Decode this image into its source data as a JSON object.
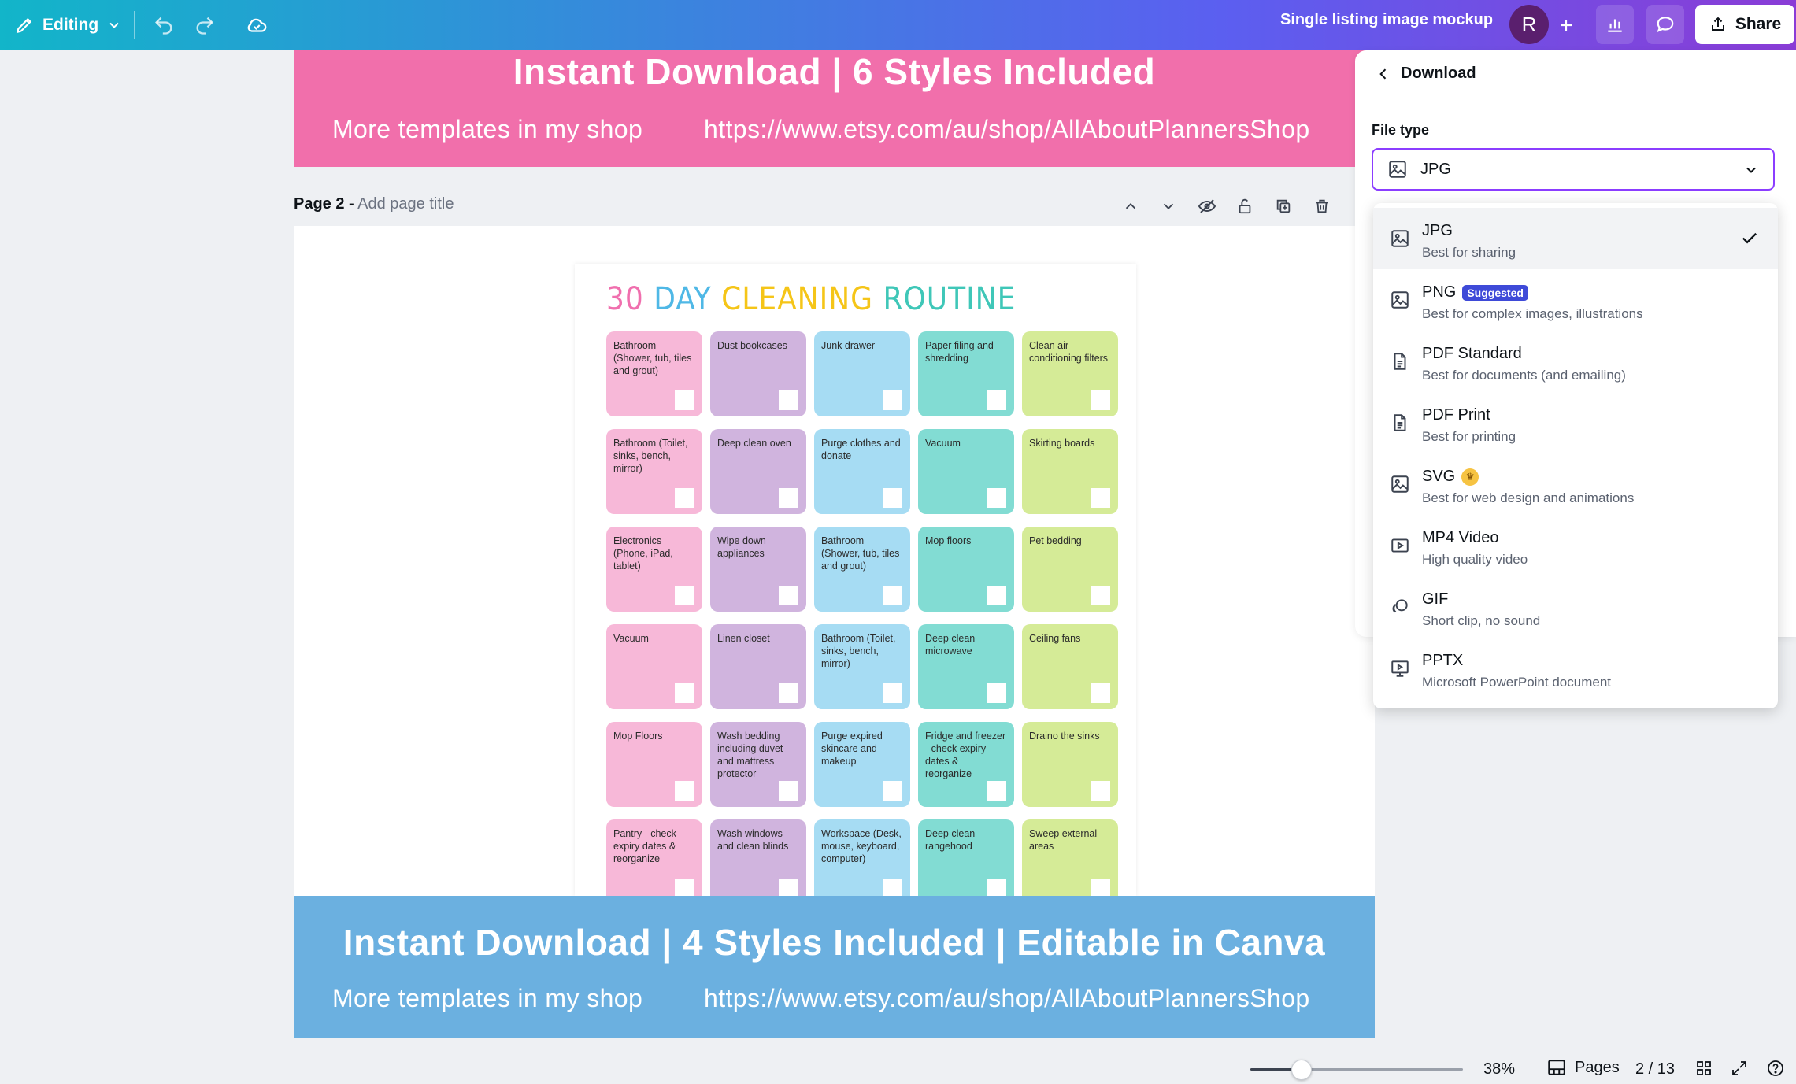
{
  "topbar": {
    "mode_label": "Editing",
    "doc_title": "Single listing image mockup",
    "avatar_initial": "R",
    "share_label": "Share"
  },
  "banners": {
    "top": {
      "headline": "Instant Download | 6 Styles Included",
      "left_text": "More templates in my shop",
      "right_text": "https://www.etsy.com/au/shop/AllAboutPlannersShop",
      "color": "#f16fab"
    },
    "bottom": {
      "headline": "Instant Download | 4 Styles Included | Editable in Canva",
      "left_text": "More templates in my shop",
      "right_text": "https://www.etsy.com/au/shop/AllAboutPlannersShop",
      "color": "#6bb0e0"
    }
  },
  "page": {
    "label": "Page 2 -",
    "title_placeholder": "Add page title"
  },
  "sheet": {
    "title_words": [
      {
        "text": "30",
        "color": "#f06fae"
      },
      {
        "text": "DAY",
        "color": "#4fb8e6"
      },
      {
        "text": "CLEANING",
        "color": "#f5c518"
      },
      {
        "text": "ROUTINE",
        "color": "#3fc7b8"
      }
    ],
    "column_colors": [
      "#f7b8d8",
      "#d0b4de",
      "#a6dcf3",
      "#82dcd3",
      "#d5eb97"
    ],
    "rows": [
      [
        "Bathroom (Shower, tub, tiles and grout)",
        "Dust bookcases",
        "Junk drawer",
        "Paper filing and shredding",
        "Clean air-conditioning filters"
      ],
      [
        "Bathroom (Toilet, sinks, bench, mirror)",
        "Deep clean oven",
        "Purge clothes and donate",
        "Vacuum",
        "Skirting boards"
      ],
      [
        "Electronics (Phone, iPad, tablet)",
        "Wipe down appliances",
        "Bathroom (Shower, tub, tiles and grout)",
        "Mop floors",
        "Pet bedding"
      ],
      [
        "Vacuum",
        "Linen closet",
        "Bathroom (Toilet, sinks, bench, mirror)",
        "Deep clean microwave",
        "Ceiling fans"
      ],
      [
        "Mop Floors",
        "Wash bedding including duvet and mattress protector",
        "Purge expired skincare and makeup",
        "Fridge and freezer - check expiry dates & reorganize",
        "Draino the sinks"
      ],
      [
        "Pantry - check expiry dates & reorganize",
        "Wash windows and clean blinds",
        "Workspace (Desk, mouse, keyboard, computer)",
        "Deep clean rangehood",
        "Sweep external areas"
      ]
    ]
  },
  "download_panel": {
    "back_label": "Download",
    "file_type_label": "File type",
    "selected_value": "JPG",
    "accent_color": "#8b3dff",
    "options": [
      {
        "name": "JPG",
        "desc": "Best for sharing",
        "icon": "image-icon",
        "selected": true
      },
      {
        "name": "PNG",
        "desc": "Best for complex images, illustrations",
        "icon": "image-icon",
        "badge": "Suggested"
      },
      {
        "name": "PDF Standard",
        "desc": "Best for documents (and emailing)",
        "icon": "document-icon"
      },
      {
        "name": "PDF Print",
        "desc": "Best for printing",
        "icon": "document-icon"
      },
      {
        "name": "SVG",
        "desc": "Best for web design and animations",
        "icon": "image-icon",
        "premium": true
      },
      {
        "name": "MP4 Video",
        "desc": "High quality video",
        "icon": "video-icon"
      },
      {
        "name": "GIF",
        "desc": "Short clip, no sound",
        "icon": "gif-icon"
      },
      {
        "name": "PPTX",
        "desc": "Microsoft PowerPoint document",
        "icon": "presentation-icon"
      }
    ]
  },
  "footer": {
    "zoom": "38%",
    "zoom_fraction": 0.24,
    "pages_label": "Pages",
    "page_counter": "2 / 13"
  }
}
